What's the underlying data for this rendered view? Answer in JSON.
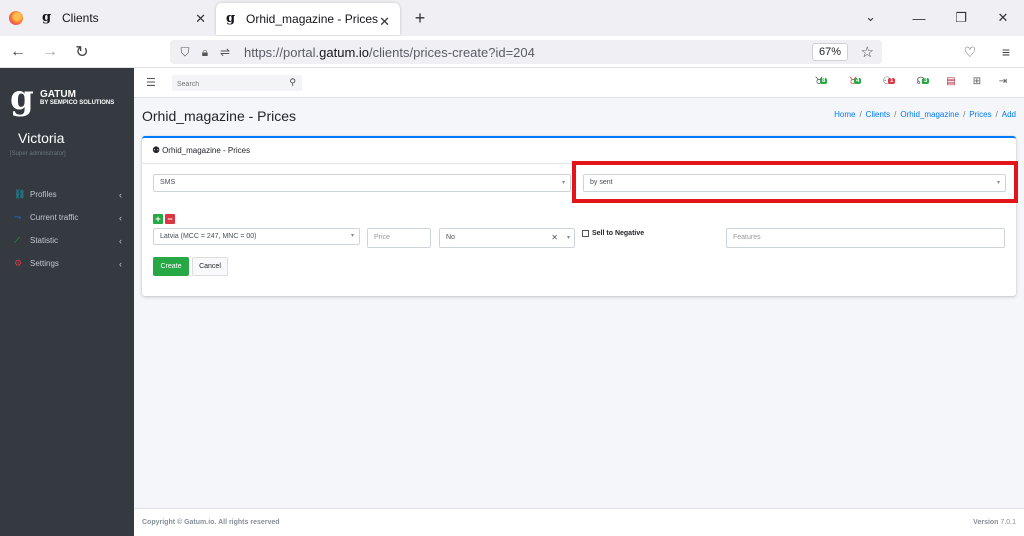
{
  "browser": {
    "tabs": [
      {
        "title": "Clients",
        "active": false
      },
      {
        "title": "Orhid_magazine - Prices",
        "active": true
      }
    ],
    "url_prefix": "https://portal.",
    "url_domain": "gatum.io",
    "url_path": "/clients/prices-create?id=204",
    "zoom": "67%"
  },
  "sidebar": {
    "brand_name": "GATUM",
    "brand_sub": "BY SEMPICO SOLUTIONS",
    "user_name": "Victoria",
    "user_role": "[Super administrator]",
    "items": [
      {
        "label": "Profiles",
        "icon": "network-icon"
      },
      {
        "label": "Current traffic",
        "icon": "traffic-icon"
      },
      {
        "label": "Statistic",
        "icon": "chart-icon"
      },
      {
        "label": "Settings",
        "icon": "gears-icon"
      }
    ]
  },
  "topbar": {
    "search_placeholder": "Search",
    "badges": [
      {
        "icon": "pig-icon",
        "count": "8",
        "color": "green"
      },
      {
        "icon": "pig-icon",
        "count": "4",
        "color": "green"
      },
      {
        "icon": "users-icon",
        "count": "1",
        "color": "red"
      },
      {
        "icon": "ear-icon",
        "count": "3",
        "color": "green"
      }
    ]
  },
  "header": {
    "title": "Orhid_magazine - Prices",
    "breadcrumb": [
      "Home",
      "Clients",
      "Orhid_magazine",
      "Prices",
      "Add"
    ]
  },
  "card": {
    "title": "Orhid_magazine - Prices",
    "type_select": "SMS",
    "mode_select": "by sent",
    "country_select": "Latvia (MCC = 247, MNC = 00)",
    "price_placeholder": "Price",
    "no_select": "No",
    "sell_negative_label": "Sell to Negative",
    "features_placeholder": "Features",
    "create_label": "Create",
    "cancel_label": "Cancel"
  },
  "footer": {
    "copyright": "Copyright © Gatum.io. All rights reserved",
    "version_label": "Version",
    "version": "7.0.1"
  },
  "colors": {
    "accent": "#007bff",
    "success": "#28a745",
    "danger": "#dc3545",
    "highlight": "#e3151a",
    "sidebar_bg": "#343a40"
  }
}
